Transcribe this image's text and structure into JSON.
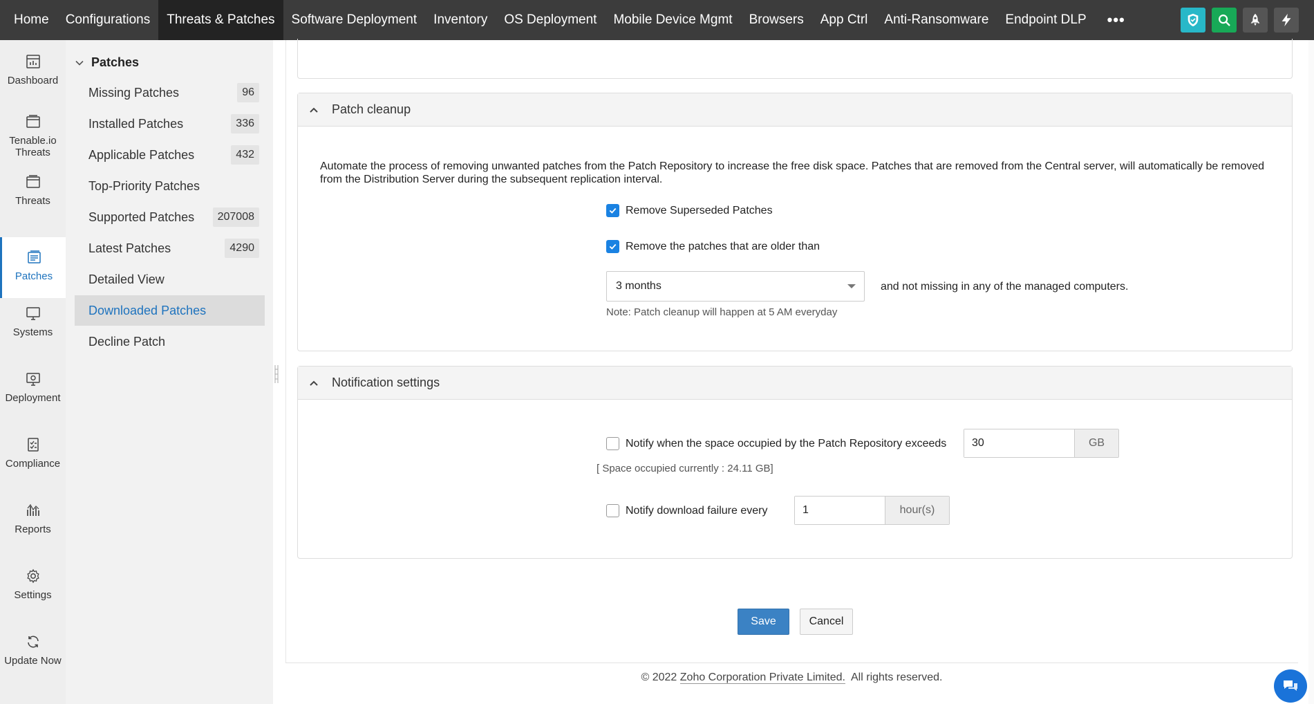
{
  "topnav": {
    "items": [
      {
        "label": "Home"
      },
      {
        "label": "Configurations"
      },
      {
        "label": "Threats & Patches"
      },
      {
        "label": "Software Deployment"
      },
      {
        "label": "Inventory"
      },
      {
        "label": "OS Deployment"
      },
      {
        "label": "Mobile Device Mgmt"
      },
      {
        "label": "Browsers"
      },
      {
        "label": "App Ctrl"
      },
      {
        "label": "Anti-Ransomware"
      },
      {
        "label": "Endpoint DLP"
      }
    ],
    "more_label": "•••",
    "active_index": 2,
    "icons": [
      "shield-icon",
      "search-icon",
      "rocket-icon",
      "lightning-icon"
    ],
    "icon_colors": {
      "shield": "#28b8c8",
      "search": "#18a957",
      "rocket": "#555555",
      "lightning": "#555555"
    }
  },
  "rail": {
    "items": [
      {
        "label": "Dashboard",
        "icon": "dashboard-icon"
      },
      {
        "label": "Tenable.io Threats",
        "icon": "tenable-icon"
      },
      {
        "label": "Threats",
        "icon": "threats-icon"
      },
      {
        "label": "Patches",
        "icon": "patches-icon"
      },
      {
        "label": "Systems",
        "icon": "systems-icon"
      },
      {
        "label": "Deployment",
        "icon": "deployment-icon"
      },
      {
        "label": "Compliance",
        "icon": "compliance-icon"
      },
      {
        "label": "Reports",
        "icon": "reports-icon"
      },
      {
        "label": "Settings",
        "icon": "settings-icon"
      },
      {
        "label": "Update Now",
        "icon": "refresh-icon"
      }
    ],
    "active_index": 3
  },
  "subnav": {
    "header": "Patches",
    "items": [
      {
        "label": "Missing Patches",
        "count": "96"
      },
      {
        "label": "Installed Patches",
        "count": "336"
      },
      {
        "label": "Applicable Patches",
        "count": "432"
      },
      {
        "label": "Top-Priority Patches",
        "count": ""
      },
      {
        "label": "Supported Patches",
        "count": "207008"
      },
      {
        "label": "Latest Patches",
        "count": "4290"
      },
      {
        "label": "Detailed View",
        "count": ""
      },
      {
        "label": "Downloaded Patches",
        "count": ""
      },
      {
        "label": "Decline Patch",
        "count": ""
      }
    ],
    "active_index": 7
  },
  "cleanup": {
    "title": "Patch cleanup",
    "description": "Automate the process of removing unwanted patches from the Patch Repository to increase the free disk space. Patches that are removed from the Central server, will automatically be removed from the Distribution Server during the subsequent replication interval.",
    "remove_superseded_label": "Remove Superseded Patches",
    "remove_superseded_checked": true,
    "remove_older_label": "Remove the patches that are older than",
    "remove_older_checked": true,
    "age_value": "3 months",
    "age_suffix": "and not missing in any of the managed computers.",
    "note": "Note: Patch cleanup will happen at 5 AM everyday"
  },
  "notification": {
    "title": "Notification settings",
    "space_label": "Notify when the space occupied by the Patch Repository exceeds",
    "space_checked": false,
    "space_value": "30",
    "space_unit": "GB",
    "space_current": "[ Space occupied currently : 24.11 GB]",
    "failure_label": "Notify download failure every",
    "failure_checked": false,
    "failure_value": "1",
    "failure_unit": "hour(s)"
  },
  "actions": {
    "save_label": "Save",
    "cancel_label": "Cancel"
  },
  "footer": {
    "prefix": "© 2022 ",
    "company": "Zoho Corporation Private Limited.",
    "suffix": "  All rights reserved."
  },
  "colors": {
    "accent": "#1e73be",
    "checkbox": "#1a82e2",
    "primary_button": "#3b82c4",
    "topnav_bg": "#3c3c3c",
    "topnav_active": "#232323",
    "chat_button": "#1a73d9"
  }
}
